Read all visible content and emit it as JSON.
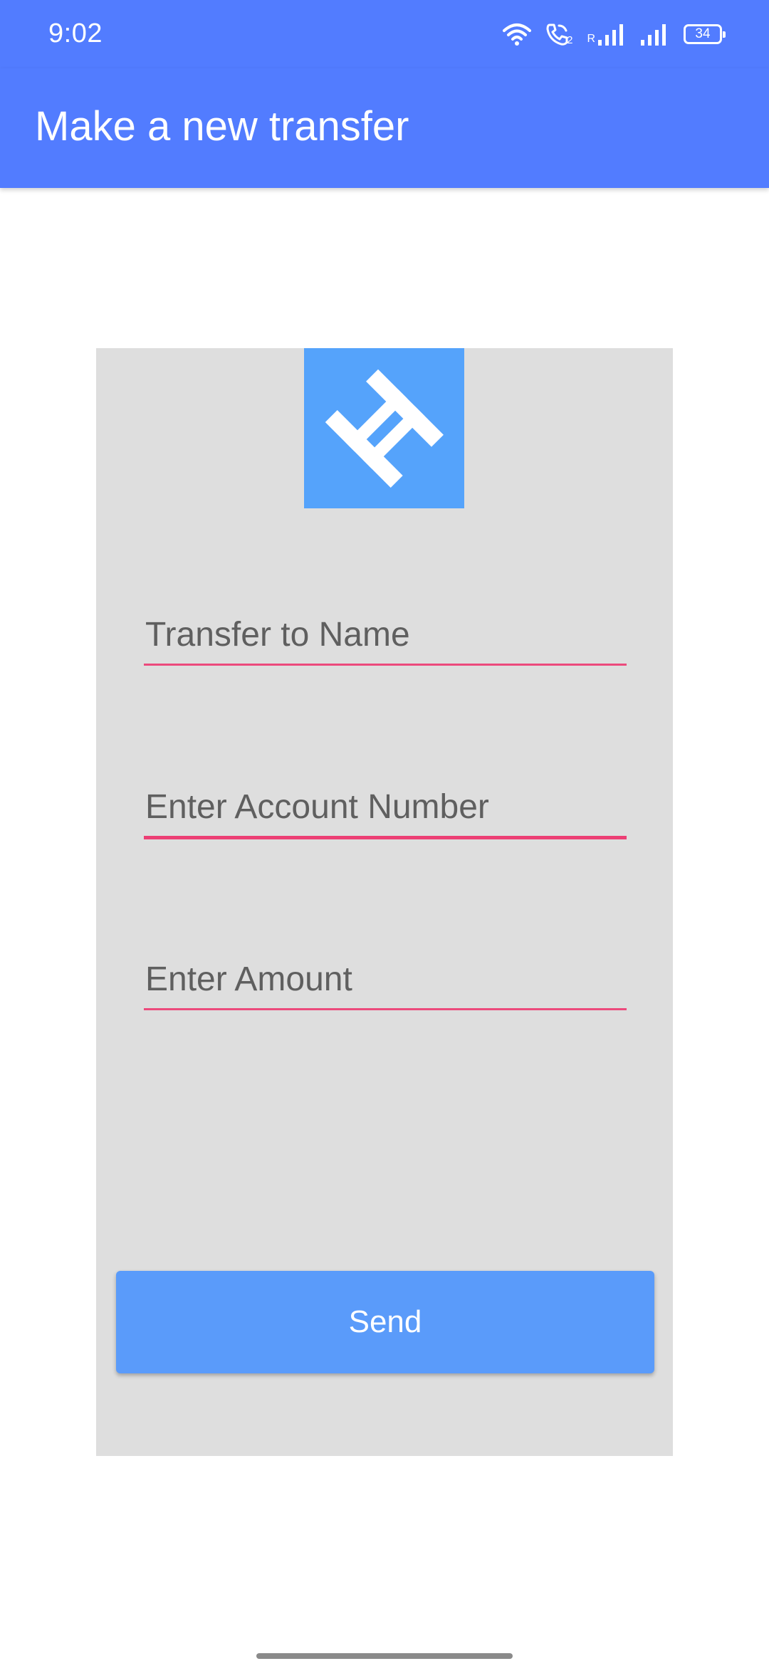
{
  "status_bar": {
    "time": "9:02",
    "network_label": "R",
    "sim_label": "2",
    "battery": "34"
  },
  "app_bar": {
    "title": "Make a new transfer"
  },
  "form": {
    "name_placeholder": "Transfer to Name",
    "account_placeholder": "Enter Account Number",
    "amount_placeholder": "Enter Amount",
    "send_label": "Send"
  },
  "colors": {
    "primary": "#527cff",
    "logo_bg": "#55a3fb",
    "card_bg": "#dedede",
    "underline": "#ec4a7c",
    "button": "#5a9bfa"
  },
  "icons": {
    "logo": "h-logo-icon",
    "wifi": "wifi-icon",
    "call": "wifi-call-icon",
    "signal": "signal-icon",
    "battery": "battery-icon"
  }
}
